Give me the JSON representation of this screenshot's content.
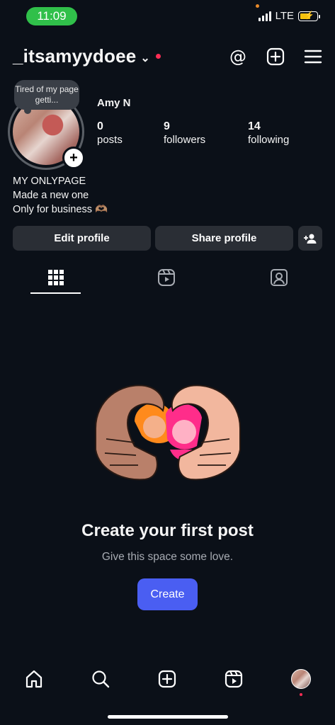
{
  "status_bar": {
    "time": "11:09",
    "network": "LTE"
  },
  "header": {
    "username": "_itsamyydoee",
    "icons": [
      "threads-icon",
      "create-plus-icon",
      "menu-icon"
    ]
  },
  "profile": {
    "note": "Tired of my page getti...",
    "name": "Amy N",
    "stats": [
      {
        "value": "0",
        "label": "posts"
      },
      {
        "value": "9",
        "label": "followers"
      },
      {
        "value": "14",
        "label": "following"
      }
    ],
    "bio": [
      "MY ONLYPAGE",
      "Made a new one",
      "Only for business 🫶🏽"
    ]
  },
  "actions": {
    "edit": "Edit profile",
    "share": "Share profile"
  },
  "tabs": [
    "grid-icon",
    "reels-icon",
    "tagged-icon"
  ],
  "empty_state": {
    "title": "Create your first post",
    "subtitle": "Give this space some love.",
    "button": "Create"
  },
  "bottom_nav": [
    "home-icon",
    "search-icon",
    "create-icon",
    "reels-icon",
    "profile-avatar"
  ],
  "colors": {
    "accent": "#4a5ef2",
    "background": "#0b1018",
    "button": "#2a2e35",
    "notification": "#ff2d55"
  }
}
